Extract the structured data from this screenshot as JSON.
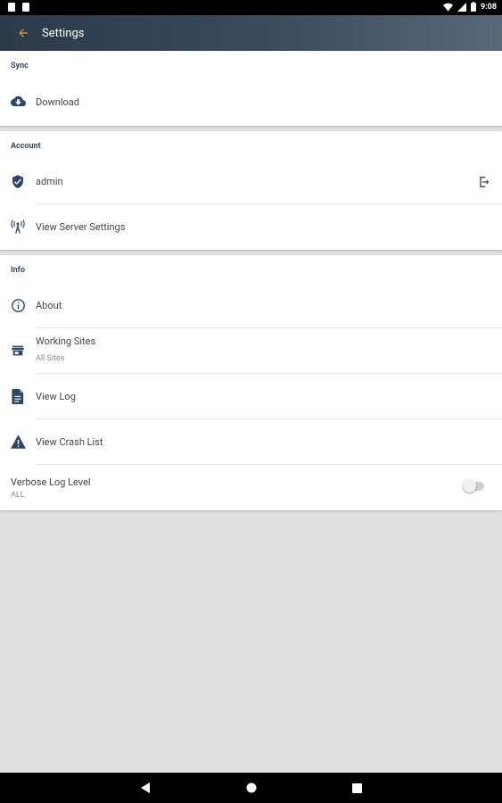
{
  "status_bar": {
    "time": "9:08"
  },
  "app_bar": {
    "title": "Settings"
  },
  "sections": {
    "sync": {
      "header": "Sync",
      "download_label": "Download"
    },
    "account": {
      "header": "Account",
      "user_label": "admin",
      "server_settings_label": "View Server Settings"
    },
    "info": {
      "header": "Info",
      "about_label": "About",
      "working_sites_label": "Working Sites",
      "working_sites_value": "All Sites",
      "view_log_label": "View Log",
      "view_crash_list_label": "View Crash List",
      "verbose_label": "Verbose Log Level",
      "verbose_value": "ALL",
      "verbose_enabled": false
    }
  },
  "colors": {
    "accent": "#f0a020",
    "icon": "#2d4866",
    "app_bar": "#3a4b5c"
  },
  "icons": [
    "arrow-back-icon",
    "cloud-download-icon",
    "shield-check-icon",
    "logout-icon",
    "antenna-icon",
    "info-icon",
    "store-icon",
    "document-icon",
    "warning-icon"
  ]
}
